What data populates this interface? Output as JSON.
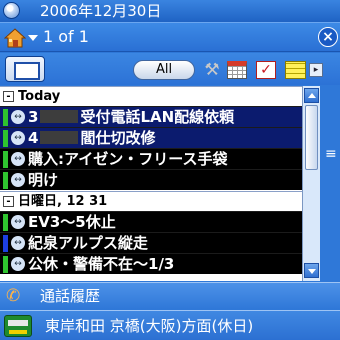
{
  "titlebar": {
    "date": "2006年12月30日"
  },
  "header": {
    "page_indicator": "1 of 1"
  },
  "toolbar": {
    "filter_label": "All"
  },
  "list": {
    "groups": [
      {
        "label": "Today",
        "expander": "-",
        "rows": [
          {
            "prefix": "3",
            "text": "受付電話LAN配線依頼",
            "status": "green",
            "redacted": true
          },
          {
            "prefix": "4",
            "text": "閻仕切改修",
            "status": "green",
            "redacted": true
          },
          {
            "prefix": "",
            "text": "購入:アイゼン・フリース手袋",
            "status": "green",
            "redacted": false
          },
          {
            "prefix": "",
            "text": "明け",
            "status": "green",
            "redacted": false
          }
        ]
      },
      {
        "label": "日曜日, 12 31",
        "expander": "-",
        "rows": [
          {
            "prefix": "",
            "text": "EV3～5休止",
            "status": "green",
            "redacted": false
          },
          {
            "prefix": "",
            "text": "紀泉アルプス縦走",
            "status": "blue",
            "redacted": false
          },
          {
            "prefix": "",
            "text": "公休・警備不在～1/3",
            "status": "green",
            "redacted": false
          }
        ]
      }
    ]
  },
  "bottom": {
    "call_history": "通話履歴",
    "transit": "東岸和田 京橋(大阪)方面(休日)"
  },
  "colors": {
    "background": "#2f78d8",
    "status_green": "#2fc42f",
    "status_blue": "#1d3fe0"
  },
  "icons": [
    "start-icon",
    "home-icon",
    "tools-icon",
    "calendar-icon",
    "task-icon",
    "memo-icon",
    "phone-icon",
    "train-icon"
  ]
}
